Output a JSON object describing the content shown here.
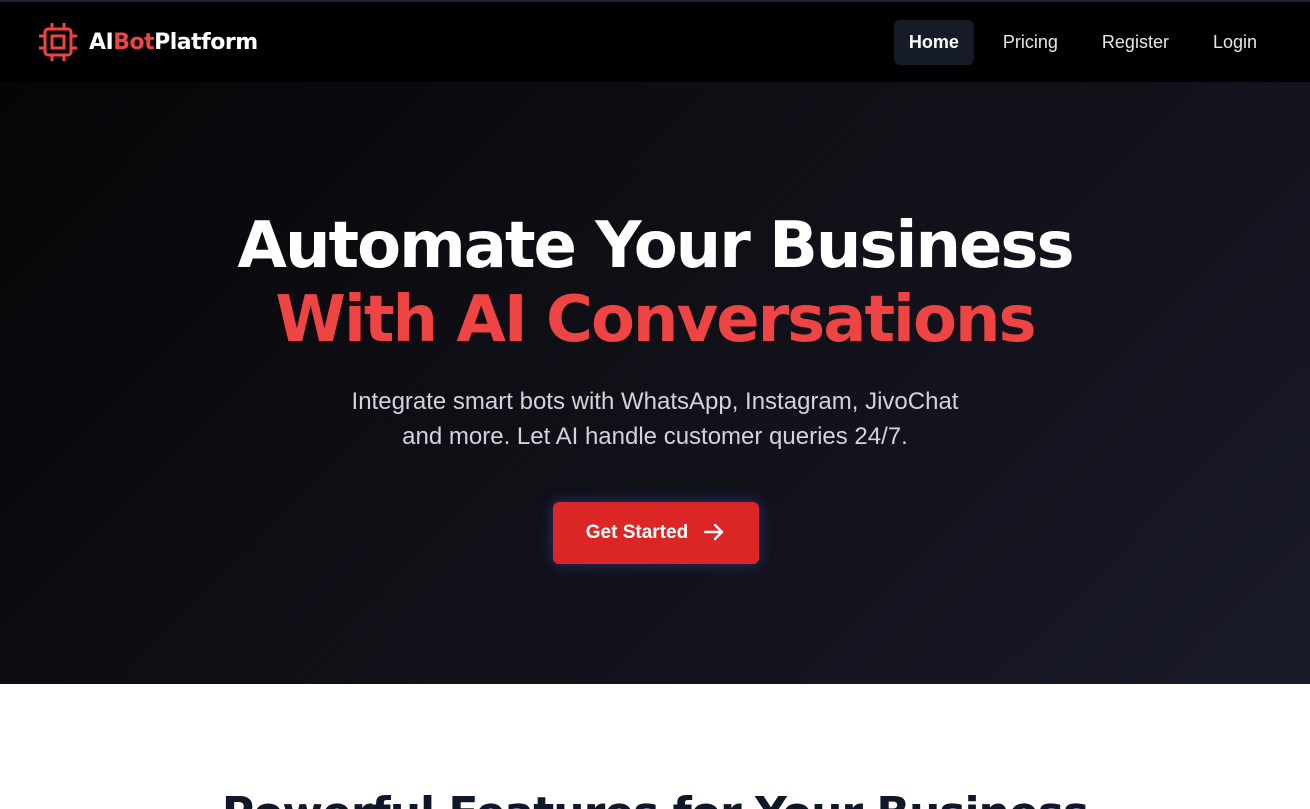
{
  "brand": {
    "prefix": "AI",
    "accent": "Bot",
    "suffix": "Platform",
    "icon": "cpu-chip-icon",
    "accent_color": "#ef4444"
  },
  "nav": {
    "items": [
      {
        "label": "Home",
        "active": true
      },
      {
        "label": "Pricing",
        "active": false
      },
      {
        "label": "Register",
        "active": false
      },
      {
        "label": "Login",
        "active": false
      }
    ]
  },
  "hero": {
    "title_line1": "Automate Your Business",
    "title_line2": "With AI Conversations",
    "subtitle": "Integrate smart bots with WhatsApp, Instagram, JivoChat and more. Let AI handle customer queries 24/7.",
    "cta_label": "Get Started",
    "cta_icon": "arrow-right-icon",
    "cta_color": "#dc2626"
  },
  "features": {
    "heading": "Powerful Features for Your Business"
  }
}
